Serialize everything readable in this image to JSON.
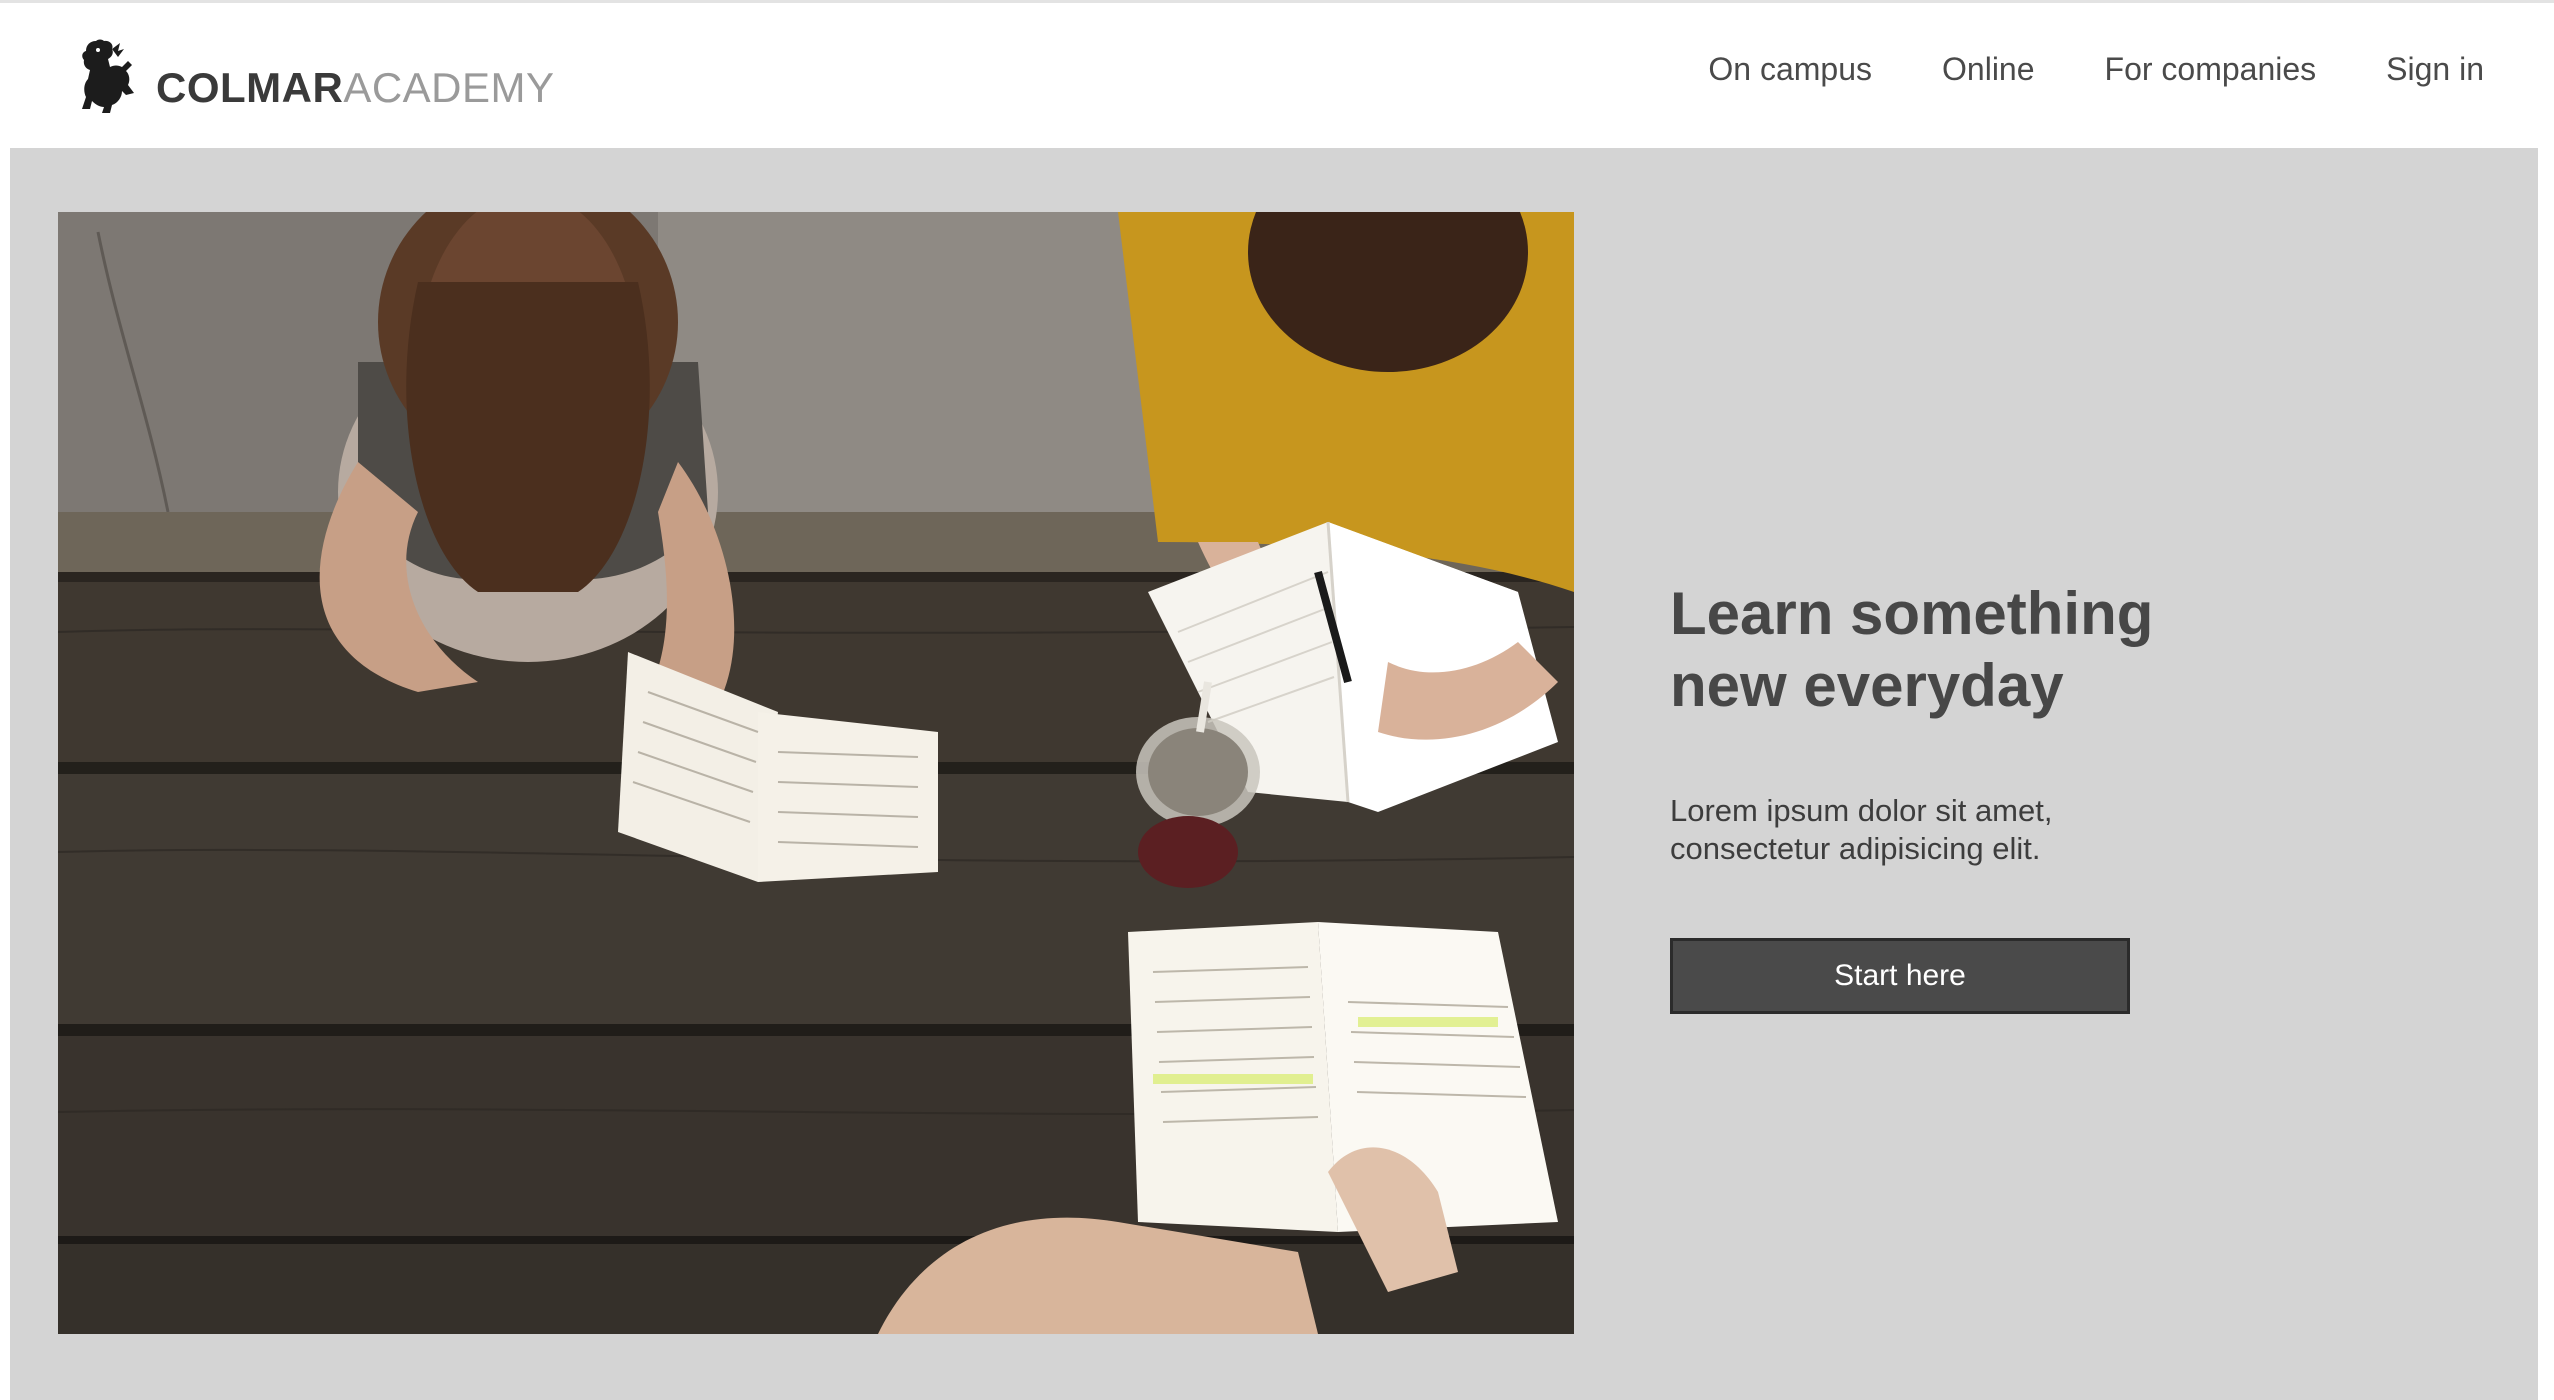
{
  "brand": {
    "name_strong": "COLMAR",
    "name_light": "ACADEMY",
    "icon": "lion-icon"
  },
  "nav": {
    "items": [
      {
        "label": "On campus"
      },
      {
        "label": "Online"
      },
      {
        "label": "For companies"
      },
      {
        "label": "Sign in"
      }
    ]
  },
  "hero": {
    "photo": "students-studying-at-wooden-table-image",
    "heading": "Learn something new everyday",
    "subtext": "Lorem ipsum dolor sit amet, consectetur adipisicing elit.",
    "cta_label": "Start here"
  },
  "colors": {
    "hero_background": "#d4d4d4",
    "button": "#4a4a4a",
    "text_dark": "#474747"
  }
}
